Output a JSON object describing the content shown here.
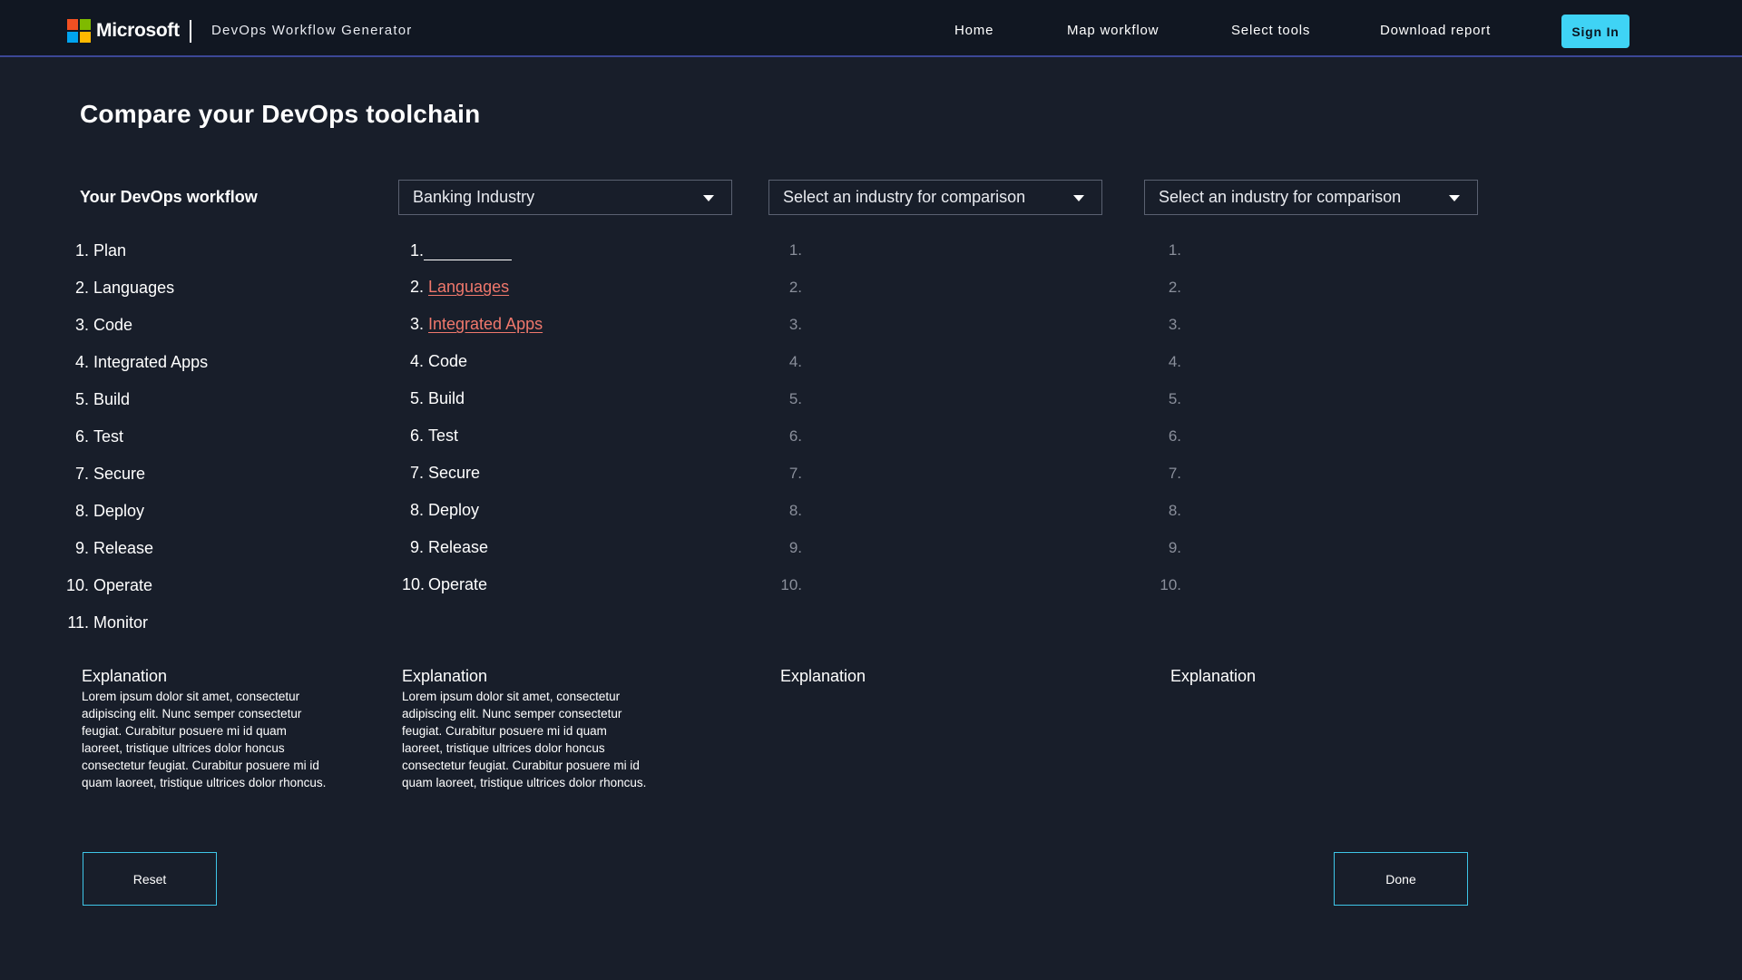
{
  "header": {
    "brand": "Microsoft",
    "app_title": "DevOps Workflow Generator",
    "nav": [
      "Home",
      "Map workflow",
      "Select tools",
      "Download report"
    ],
    "signin_label": "Sign In",
    "logo_colors": [
      "#f25022",
      "#7fba00",
      "#00a4ef",
      "#ffb900"
    ]
  },
  "page_title": "Compare your DevOps toolchain",
  "workflow_heading": "Your DevOps workflow",
  "selects": {
    "first": "Banking Industry",
    "second": "Select an industry for comparison",
    "third": "Select an industry for comparison"
  },
  "your_workflow": [
    {
      "num": "1.",
      "label": "Plan"
    },
    {
      "num": "2.",
      "label": "Languages"
    },
    {
      "num": "3.",
      "label": "Code"
    },
    {
      "num": "4.",
      "label": "Integrated Apps"
    },
    {
      "num": "5.",
      "label": "Build"
    },
    {
      "num": "6.",
      "label": "Test"
    },
    {
      "num": "7.",
      "label": "Secure"
    },
    {
      "num": "8.",
      "label": "Deploy"
    },
    {
      "num": "9.",
      "label": "Release"
    },
    {
      "num": "10.",
      "label": "Operate"
    },
    {
      "num": "11.",
      "label": "Monitor"
    }
  ],
  "industry_workflow": [
    {
      "num": "1.",
      "label": ""
    },
    {
      "num": "2.",
      "label": "Languages"
    },
    {
      "num": "3.",
      "label": "Integrated Apps"
    },
    {
      "num": "4.",
      "label": "Code"
    },
    {
      "num": "5.",
      "label": "Build"
    },
    {
      "num": "6.",
      "label": "Test"
    },
    {
      "num": "7.",
      "label": "Secure"
    },
    {
      "num": "8.",
      "label": "Deploy"
    },
    {
      "num": "9.",
      "label": "Release"
    },
    {
      "num": "10.",
      "label": "Operate"
    }
  ],
  "empty_numbers": [
    "1.",
    "2.",
    "3.",
    "4.",
    "5.",
    "6.",
    "7.",
    "8.",
    "9.",
    "10."
  ],
  "explanation": {
    "title": "Explanation",
    "text_col1": "Lorem ipsum dolor sit amet, consectetur adipiscing elit. Nunc semper consectetur feugiat. Curabitur posuere mi id quam laoreet, tristique ultrices dolor honcus consectetur feugiat. Curabitur posuere mi id quam laoreet, tristique ultrices dolor rhoncus.",
    "text_col2": "Lorem ipsum dolor sit amet, consectetur adipiscing elit. Nunc semper consectetur feugiat. Curabitur posuere mi id quam laoreet, tristique ultrices dolor honcus consectetur feugiat. Curabitur posuere mi id quam laoreet, tristique ultrices dolor rhoncus."
  },
  "buttons": {
    "reset": "Reset",
    "done": "Done"
  },
  "colors": {
    "accent_link": "#f0786c",
    "signin_bg": "#3fd3f5",
    "button_border": "#3ec6e8",
    "background": "#181e2a"
  }
}
